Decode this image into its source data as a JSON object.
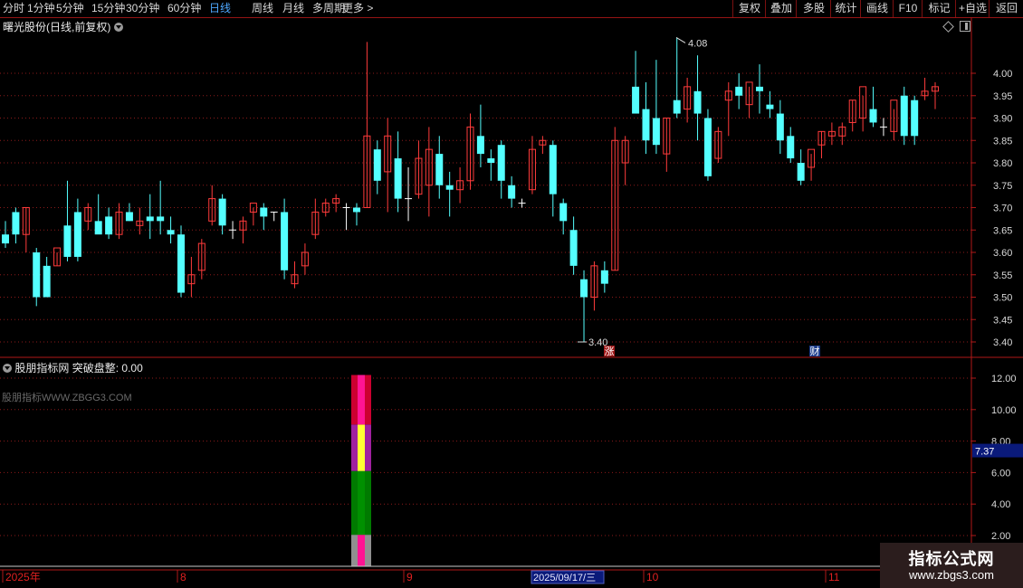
{
  "toolbar": {
    "periods": [
      "分时",
      "1分钟",
      "5分钟",
      "15分钟",
      "30分钟",
      "60分钟",
      "日线",
      "周线",
      "月线",
      "多周期",
      "更多 >"
    ],
    "active_period": "日线",
    "right_buttons": [
      "复权",
      "叠加",
      "多股",
      "统计",
      "画线",
      "F10",
      "标记",
      "+自选",
      "返回"
    ]
  },
  "main_chart": {
    "title": "曙光股份(日线,前复权)",
    "high_label": "4.08",
    "low_label": "3.40",
    "event_marks": [
      "涨",
      "财"
    ],
    "y_axis_ticks": [
      "4.00",
      "3.95",
      "3.90",
      "3.85",
      "3.80",
      "3.75",
      "3.70",
      "3.65",
      "3.60",
      "3.55",
      "3.50",
      "3.45",
      "3.40"
    ]
  },
  "indicator_panel": {
    "name": "股朋指标网",
    "indicator": "突破盘整",
    "value": "0.00",
    "watermark": "股朋指标WWW.ZBGG3.COM",
    "y_axis_ticks": [
      "12.00",
      "10.00",
      "8.00",
      "6.00",
      "4.00",
      "2.00"
    ],
    "current_value_tag": "7.37"
  },
  "time_axis": {
    "labels": [
      "2025年",
      "8",
      "9",
      "10",
      "11"
    ],
    "cursor_date": "2025/09/17/三"
  },
  "logo": {
    "line1": "指标公式网",
    "line2": "www.zbgs3.com"
  },
  "colors": {
    "up": "#ff3b3b",
    "down": "#54ffff",
    "grid": "#8b1a1a",
    "axis": "#b01818",
    "active_tab": "#4ea8ff",
    "value_tag_bg": "#0a1a7a"
  },
  "chart_data": {
    "type": "candlestick",
    "y_range": [
      3.38,
      4.12
    ],
    "candles": [
      [
        3.64,
        3.67,
        3.62,
        3.61
      ],
      [
        3.69,
        3.7,
        3.64,
        3.62
      ],
      [
        3.64,
        3.7,
        3.7,
        3.6
      ],
      [
        3.6,
        3.61,
        3.5,
        3.48
      ],
      [
        3.57,
        3.59,
        3.5,
        3.5
      ],
      [
        3.57,
        3.6,
        3.61,
        3.57
      ],
      [
        3.66,
        3.76,
        3.59,
        3.58
      ],
      [
        3.69,
        3.72,
        3.59,
        3.58
      ],
      [
        3.67,
        3.71,
        3.7,
        3.65
      ],
      [
        3.67,
        3.73,
        3.64,
        3.65
      ],
      [
        3.68,
        3.7,
        3.64,
        3.63
      ],
      [
        3.64,
        3.71,
        3.69,
        3.63
      ],
      [
        3.69,
        3.71,
        3.67,
        3.67
      ],
      [
        3.66,
        3.7,
        3.67,
        3.64
      ],
      [
        3.68,
        3.73,
        3.67,
        3.63
      ],
      [
        3.68,
        3.76,
        3.67,
        3.64
      ],
      [
        3.65,
        3.68,
        3.64,
        3.62
      ],
      [
        3.64,
        3.66,
        3.51,
        3.5
      ],
      [
        3.53,
        3.59,
        3.55,
        3.5
      ],
      [
        3.56,
        3.63,
        3.62,
        3.54
      ],
      [
        3.67,
        3.75,
        3.72,
        3.66
      ],
      [
        3.72,
        3.73,
        3.66,
        3.64
      ],
      [
        3.65,
        3.67,
        3.65,
        3.63
      ],
      [
        3.65,
        3.68,
        3.67,
        3.62
      ],
      [
        3.69,
        3.7,
        3.71,
        3.66
      ],
      [
        3.7,
        3.71,
        3.68,
        3.65
      ],
      [
        3.69,
        3.69,
        3.69,
        3.67
      ],
      [
        3.69,
        3.72,
        3.56,
        3.54
      ],
      [
        3.53,
        3.58,
        3.55,
        3.52
      ],
      [
        3.57,
        3.62,
        3.6,
        3.55
      ],
      [
        3.64,
        3.72,
        3.69,
        3.63
      ],
      [
        3.69,
        3.72,
        3.71,
        3.68
      ],
      [
        3.71,
        3.73,
        3.72,
        3.69
      ],
      [
        3.7,
        3.71,
        3.7,
        3.65
      ],
      [
        3.7,
        3.71,
        3.69,
        3.66
      ],
      [
        3.7,
        4.07,
        3.86,
        3.7
      ],
      [
        3.83,
        3.85,
        3.76,
        3.73
      ],
      [
        3.78,
        3.9,
        3.86,
        3.69
      ],
      [
        3.81,
        3.87,
        3.72,
        3.69
      ],
      [
        3.72,
        3.79,
        3.72,
        3.67
      ],
      [
        3.73,
        3.85,
        3.81,
        3.72
      ],
      [
        3.75,
        3.88,
        3.83,
        3.68
      ],
      [
        3.82,
        3.86,
        3.75,
        3.72
      ],
      [
        3.75,
        3.78,
        3.74,
        3.68
      ],
      [
        3.74,
        3.79,
        3.76,
        3.71
      ],
      [
        3.76,
        3.91,
        3.88,
        3.74
      ],
      [
        3.86,
        3.93,
        3.82,
        3.79
      ],
      [
        3.81,
        3.83,
        3.8,
        3.76
      ],
      [
        3.84,
        3.85,
        3.76,
        3.72
      ],
      [
        3.75,
        3.77,
        3.72,
        3.7
      ],
      [
        3.71,
        3.72,
        3.71,
        3.7
      ],
      [
        3.74,
        3.86,
        3.83,
        3.73
      ],
      [
        3.84,
        3.86,
        3.85,
        3.82
      ],
      [
        3.84,
        3.85,
        3.73,
        3.68
      ],
      [
        3.71,
        3.72,
        3.67,
        3.64
      ],
      [
        3.65,
        3.68,
        3.57,
        3.55
      ],
      [
        3.54,
        3.56,
        3.5,
        3.4
      ],
      [
        3.5,
        3.58,
        3.57,
        3.47
      ],
      [
        3.56,
        3.58,
        3.53,
        3.51
      ],
      [
        3.56,
        3.88,
        3.85,
        3.56
      ],
      [
        3.8,
        3.86,
        3.85,
        3.75
      ],
      [
        3.97,
        4.05,
        3.91,
        3.93
      ],
      [
        3.92,
        3.98,
        3.85,
        3.82
      ],
      [
        3.9,
        4.03,
        3.84,
        3.82
      ],
      [
        3.82,
        3.9,
        3.9,
        3.78
      ],
      [
        3.94,
        4.08,
        3.91,
        3.9
      ],
      [
        3.92,
        3.99,
        3.97,
        3.89
      ],
      [
        3.96,
        4.04,
        3.91,
        3.85
      ],
      [
        3.9,
        3.92,
        3.77,
        3.76
      ],
      [
        3.81,
        3.88,
        3.87,
        3.8
      ],
      [
        3.94,
        3.98,
        3.96,
        3.86
      ],
      [
        3.97,
        4.0,
        3.95,
        3.92
      ],
      [
        3.93,
        3.97,
        3.98,
        3.9
      ],
      [
        3.97,
        4.02,
        3.96,
        3.91
      ],
      [
        3.93,
        3.96,
        3.92,
        3.9
      ],
      [
        3.91,
        3.94,
        3.85,
        3.82
      ],
      [
        3.86,
        3.88,
        3.81,
        3.8
      ],
      [
        3.8,
        3.83,
        3.76,
        3.75
      ],
      [
        3.79,
        3.82,
        3.83,
        3.76
      ],
      [
        3.84,
        3.87,
        3.87,
        3.81
      ],
      [
        3.86,
        3.89,
        3.87,
        3.84
      ],
      [
        3.86,
        3.89,
        3.88,
        3.84
      ],
      [
        3.89,
        3.94,
        3.94,
        3.87
      ],
      [
        3.9,
        3.95,
        3.97,
        3.87
      ],
      [
        3.92,
        3.97,
        3.89,
        3.88
      ],
      [
        3.88,
        3.9,
        3.88,
        3.86
      ],
      [
        3.87,
        3.92,
        3.94,
        3.85
      ],
      [
        3.95,
        3.97,
        3.86,
        3.84
      ],
      [
        3.94,
        3.95,
        3.86,
        3.84
      ],
      [
        3.95,
        3.99,
        3.96,
        3.94
      ],
      [
        3.96,
        3.98,
        3.97,
        3.92
      ]
    ],
    "indicator_bar_segments": [
      {
        "from": 0,
        "to": 2.05,
        "color": "#ff1493"
      },
      {
        "from": 2.05,
        "to": 6.1,
        "color": "#009000"
      },
      {
        "from": 6.1,
        "to": 9.05,
        "color": "#ffff33"
      },
      {
        "from": 9.05,
        "to": 12.2,
        "color": "#ff1493"
      }
    ],
    "indicator_y_range": [
      0,
      12.6
    ]
  }
}
